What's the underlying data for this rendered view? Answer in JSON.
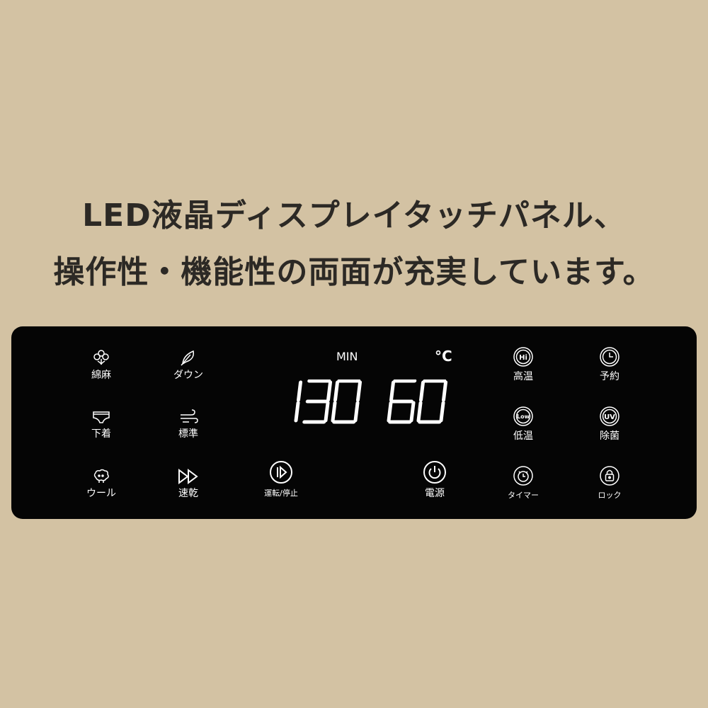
{
  "headline": {
    "line1": "LED液晶ディスプレイタッチパネル、",
    "line2": "操作性・機能性の両面が充実しています。"
  },
  "colors": {
    "background": "#d3c2a3",
    "panel": "#050505",
    "segment": "#ffffff",
    "headline_text": "#2c2925"
  },
  "display": {
    "time_unit": "MIN",
    "temp_unit": "°C",
    "time_value": "130",
    "temp_value": "60"
  },
  "buttons": {
    "cotton": {
      "label": "綿麻",
      "icon": "cotton-flower-icon"
    },
    "down": {
      "label": "ダウン",
      "icon": "feather-icon"
    },
    "underwear": {
      "label": "下着",
      "icon": "underwear-icon"
    },
    "standard": {
      "label": "標準",
      "icon": "wind-icon"
    },
    "wool": {
      "label": "ウール",
      "icon": "sheep-icon"
    },
    "quick": {
      "label": "速乾",
      "icon": "fast-forward-icon"
    },
    "start_stop": {
      "label": "運転/停止",
      "icon": "play-pause-icon"
    },
    "power": {
      "label": "電源",
      "icon": "power-icon"
    },
    "high_temp": {
      "label": "高温",
      "badge": "Hi"
    },
    "reservation": {
      "label": "予約",
      "icon": "clock-icon"
    },
    "low_temp": {
      "label": "低温",
      "badge": "Low"
    },
    "sterilize": {
      "label": "除菌",
      "badge": "UV"
    },
    "timer": {
      "label": "タイマー",
      "icon": "alarm-clock-icon"
    },
    "lock": {
      "label": "ロック",
      "icon": "lock-icon"
    }
  }
}
